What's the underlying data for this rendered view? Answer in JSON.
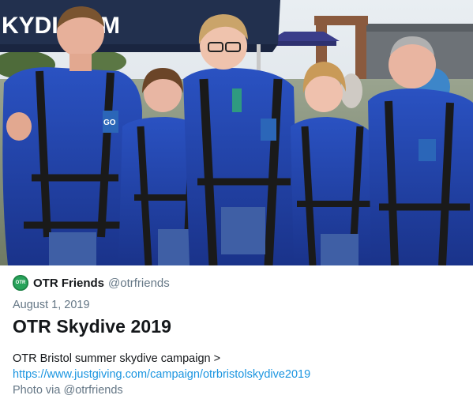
{
  "photo": {
    "banner_text": "KYDI  COM",
    "suit_badge_text": "GO"
  },
  "author": {
    "avatar_text": "OTR",
    "name": "OTR Friends",
    "handle": "@otrfriends"
  },
  "post": {
    "date": "August 1, 2019",
    "title": "OTR Skydive 2019",
    "description": "OTR Bristol summer skydive campaign >",
    "link": "https://www.justgiving.com/campaign/otrbristolskydive2019",
    "credit": "Photo via @otrfriends"
  },
  "colors": {
    "link": "#1b95e0",
    "muted": "#657786",
    "text": "#14171a",
    "suit": "#1f3f9c",
    "avatar": "#27a35a"
  }
}
